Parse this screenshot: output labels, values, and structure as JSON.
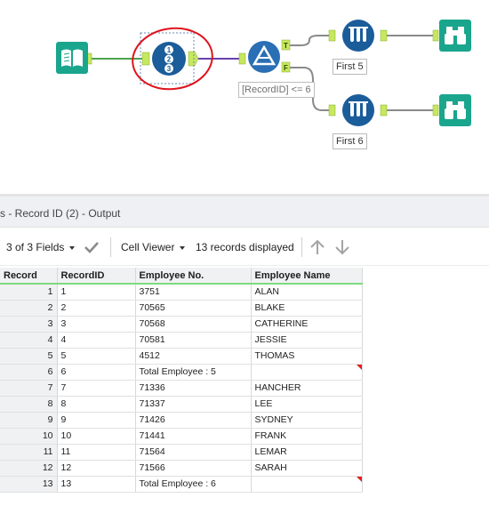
{
  "canvas": {
    "tools": {
      "input": {
        "icon": "book-input-icon"
      },
      "record_id": {
        "icon": "record-id-icon",
        "glyphs": [
          "1",
          "2",
          "3"
        ]
      },
      "filter": {
        "icon": "filter-icon",
        "true_anchor": "T",
        "false_anchor": "F",
        "expression": "[RecordID] <= 6"
      },
      "sample_top": {
        "icon": "sample-icon",
        "label": "First 5"
      },
      "sample_bottom": {
        "icon": "sample-icon",
        "label": "First 6"
      },
      "browse_top": {
        "icon": "binoculars-icon"
      },
      "browse_bottom": {
        "icon": "binoculars-icon"
      }
    },
    "colors": {
      "teal": "#1aa58d",
      "navy": "#1b5c9a",
      "filter_blue": "#2a6fb5",
      "annotation_red": "#e0121c",
      "wire_green": "#4aa34a",
      "wire_purple": "#6a3fb0",
      "wire_gray": "#8a8a8a"
    }
  },
  "results": {
    "title": "s - Record ID (2) - Output",
    "toolbar": {
      "fields": "3 of 3 Fields",
      "cell_viewer": "Cell Viewer",
      "records": "13 records displayed"
    },
    "columns": [
      "Record",
      "RecordID",
      "Employee No.",
      "Employee Name"
    ],
    "rows": [
      {
        "record": "1",
        "id": "1",
        "emp_no": "3751",
        "name": "ALAN"
      },
      {
        "record": "2",
        "id": "2",
        "emp_no": "70565",
        "name": "BLAKE"
      },
      {
        "record": "3",
        "id": "3",
        "emp_no": "70568",
        "name": "CATHERINE"
      },
      {
        "record": "4",
        "id": "4",
        "emp_no": "70581",
        "name": "JESSIE"
      },
      {
        "record": "5",
        "id": "5",
        "emp_no": "4512",
        "name": "THOMAS"
      },
      {
        "record": "6",
        "id": "6",
        "emp_no": "Total Employee : 5",
        "name": ""
      },
      {
        "record": "7",
        "id": "7",
        "emp_no": "71336",
        "name": "HANCHER"
      },
      {
        "record": "8",
        "id": "8",
        "emp_no": "71337",
        "name": "LEE"
      },
      {
        "record": "9",
        "id": "9",
        "emp_no": "71426",
        "name": "SYDNEY"
      },
      {
        "record": "10",
        "id": "10",
        "emp_no": "71441",
        "name": "FRANK"
      },
      {
        "record": "11",
        "id": "11",
        "emp_no": "71564",
        "name": "LEMAR"
      },
      {
        "record": "12",
        "id": "12",
        "emp_no": "71566",
        "name": "SARAH"
      },
      {
        "record": "13",
        "id": "13",
        "emp_no": "Total Employee : 6",
        "name": ""
      }
    ]
  }
}
